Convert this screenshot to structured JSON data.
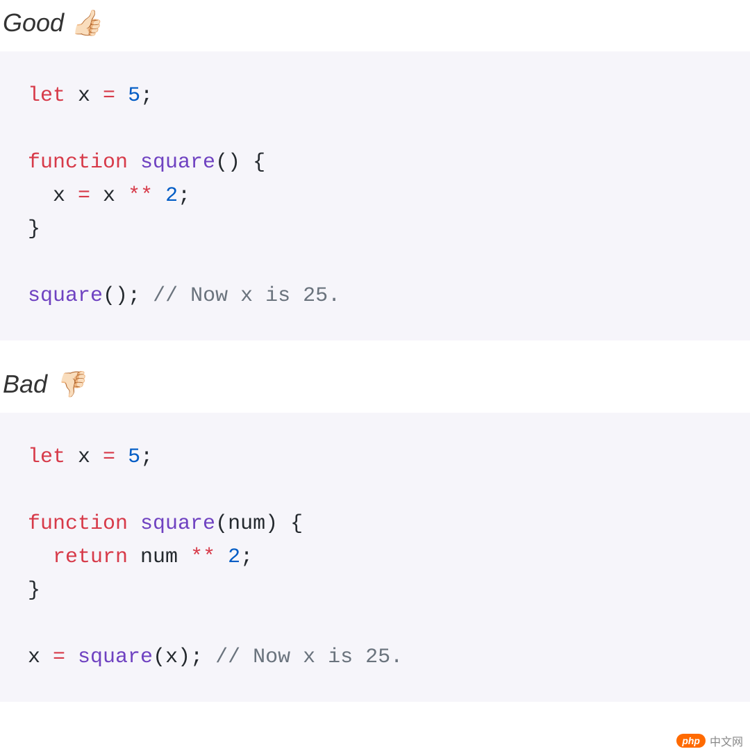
{
  "good": {
    "label": "Good 👍🏻",
    "code": {
      "l1": {
        "kw": "let",
        "var": " x ",
        "eq": "=",
        "sp": " ",
        "num": "5",
        "semi": ";"
      },
      "l3": {
        "kw": "function",
        "sp": " ",
        "name": "square",
        "paren": "()",
        "brace": " {"
      },
      "l4": {
        "indent": "  ",
        "var": "x ",
        "eq": "=",
        "rhs": " x ",
        "op": "**",
        "sp": " ",
        "num": "2",
        "semi": ";"
      },
      "l5": {
        "brace": "}"
      },
      "l7": {
        "call": "square",
        "paren": "();",
        "sp": " ",
        "comment": "// Now x is 25."
      }
    }
  },
  "bad": {
    "label": "Bad 👎🏻",
    "code": {
      "l1": {
        "kw": "let",
        "var": " x ",
        "eq": "=",
        "sp": " ",
        "num": "5",
        "semi": ";"
      },
      "l3": {
        "kw": "function",
        "sp": " ",
        "name": "square",
        "po": "(",
        "param": "num",
        "pc": ")",
        "brace": " {"
      },
      "l4": {
        "indent": "  ",
        "kw": "return",
        "var": " num ",
        "op": "**",
        "sp": " ",
        "num": "2",
        "semi": ";"
      },
      "l5": {
        "brace": "}"
      },
      "l7": {
        "lhs": "x ",
        "eq": "=",
        "sp": " ",
        "call": "square",
        "po": "(",
        "arg": "x",
        "pc": ");",
        "sp2": " ",
        "comment": "// Now x is 25."
      }
    }
  },
  "watermark": {
    "badge": "php",
    "text": "中文网"
  }
}
